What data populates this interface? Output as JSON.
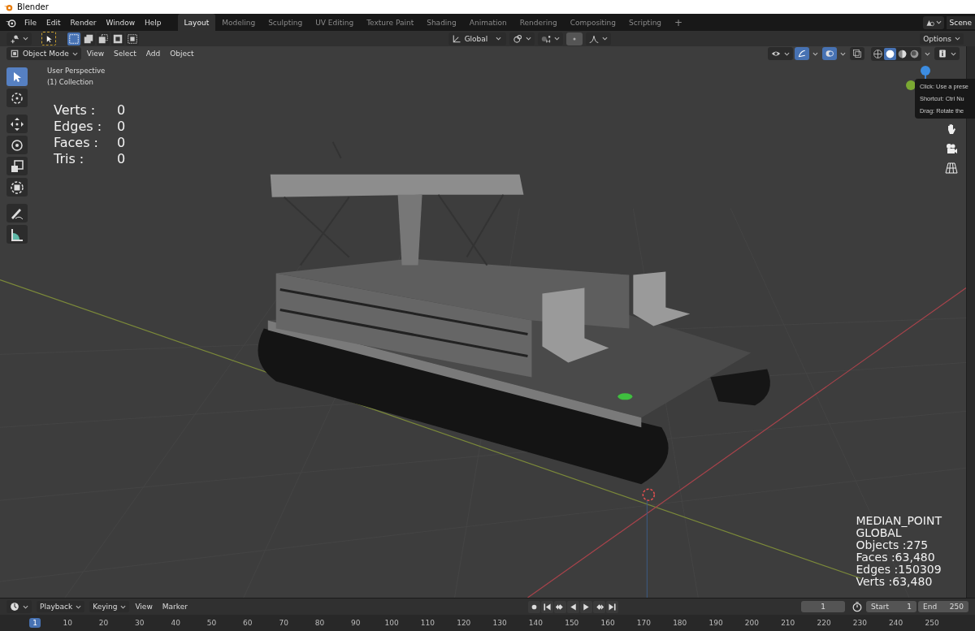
{
  "window": {
    "title": "Blender"
  },
  "menu": [
    "File",
    "Edit",
    "Render",
    "Window",
    "Help"
  ],
  "workspaces": [
    {
      "label": "Layout",
      "selected": true
    },
    {
      "label": "Modeling",
      "selected": false
    },
    {
      "label": "Sculpting",
      "selected": false
    },
    {
      "label": "UV Editing",
      "selected": false
    },
    {
      "label": "Texture Paint",
      "selected": false
    },
    {
      "label": "Shading",
      "selected": false
    },
    {
      "label": "Animation",
      "selected": false
    },
    {
      "label": "Rendering",
      "selected": false
    },
    {
      "label": "Compositing",
      "selected": false
    },
    {
      "label": "Scripting",
      "selected": false
    }
  ],
  "add_workspace": "+",
  "scene": "Scene",
  "tool_header": {
    "select_modes": [
      {
        "kind": "set",
        "selected": true
      },
      {
        "kind": "extend",
        "selected": false
      },
      {
        "kind": "subtract",
        "selected": false
      },
      {
        "kind": "difference",
        "selected": false
      },
      {
        "kind": "intersect",
        "selected": false
      }
    ],
    "orientation": "Global",
    "options": "Options"
  },
  "viewport_header": {
    "mode": "Object Mode",
    "menus": [
      "View",
      "Select",
      "Add",
      "Object"
    ],
    "gizmos_on": true,
    "overlays_on": true,
    "xray_on": false,
    "shading": [
      {
        "kind": "wireframe",
        "selected": false
      },
      {
        "kind": "solid",
        "selected": true
      },
      {
        "kind": "material",
        "selected": false
      },
      {
        "kind": "rendered",
        "selected": false
      }
    ]
  },
  "toolbar": [
    {
      "kind": "select",
      "selected": true
    },
    {
      "kind": "cursor",
      "selected": false
    },
    {
      "kind": "move",
      "selected": false
    },
    {
      "kind": "rotate",
      "selected": false
    },
    {
      "kind": "scale",
      "selected": false
    },
    {
      "kind": "transform",
      "selected": false
    },
    {
      "kind": "annotate",
      "selected": false
    },
    {
      "kind": "measure",
      "selected": false
    }
  ],
  "viewport": {
    "view_name": "User Perspective",
    "collection": "(1) Collection",
    "stats": [
      {
        "label": "Verts :",
        "value": "0"
      },
      {
        "label": "Edges :",
        "value": "0"
      },
      {
        "label": "Faces :",
        "value": "0"
      },
      {
        "label": "Tris :",
        "value": "0"
      }
    ],
    "tooltip": [
      "Click: Use a prese",
      "Shortcut: Ctrl Nu",
      "Drag: Rotate the"
    ],
    "scene_info": [
      "MEDIAN_POINT",
      "GLOBAL",
      "Objects :275",
      "Faces :63,480",
      "Edges :150309",
      "Verts :63,480"
    ]
  },
  "timeline": {
    "menus": [
      "Playback",
      "Keying",
      "View",
      "Marker"
    ],
    "current_frame": "1",
    "start_label": "Start",
    "start": "1",
    "end_label": "End",
    "end": "250",
    "ruler": [
      {
        "label": "1",
        "selected": true
      },
      {
        "label": "10",
        "selected": false
      },
      {
        "label": "20",
        "selected": false
      },
      {
        "label": "30",
        "selected": false
      },
      {
        "label": "40",
        "selected": false
      },
      {
        "label": "50",
        "selected": false
      },
      {
        "label": "60",
        "selected": false
      },
      {
        "label": "70",
        "selected": false
      },
      {
        "label": "80",
        "selected": false
      },
      {
        "label": "90",
        "selected": false
      },
      {
        "label": "100",
        "selected": false
      },
      {
        "label": "110",
        "selected": false
      },
      {
        "label": "120",
        "selected": false
      },
      {
        "label": "130",
        "selected": false
      },
      {
        "label": "140",
        "selected": false
      },
      {
        "label": "150",
        "selected": false
      },
      {
        "label": "160",
        "selected": false
      },
      {
        "label": "170",
        "selected": false
      },
      {
        "label": "180",
        "selected": false
      },
      {
        "label": "190",
        "selected": false
      },
      {
        "label": "200",
        "selected": false
      },
      {
        "label": "210",
        "selected": false
      },
      {
        "label": "220",
        "selected": false
      },
      {
        "label": "230",
        "selected": false
      },
      {
        "label": "240",
        "selected": false
      },
      {
        "label": "250",
        "selected": false
      }
    ]
  }
}
